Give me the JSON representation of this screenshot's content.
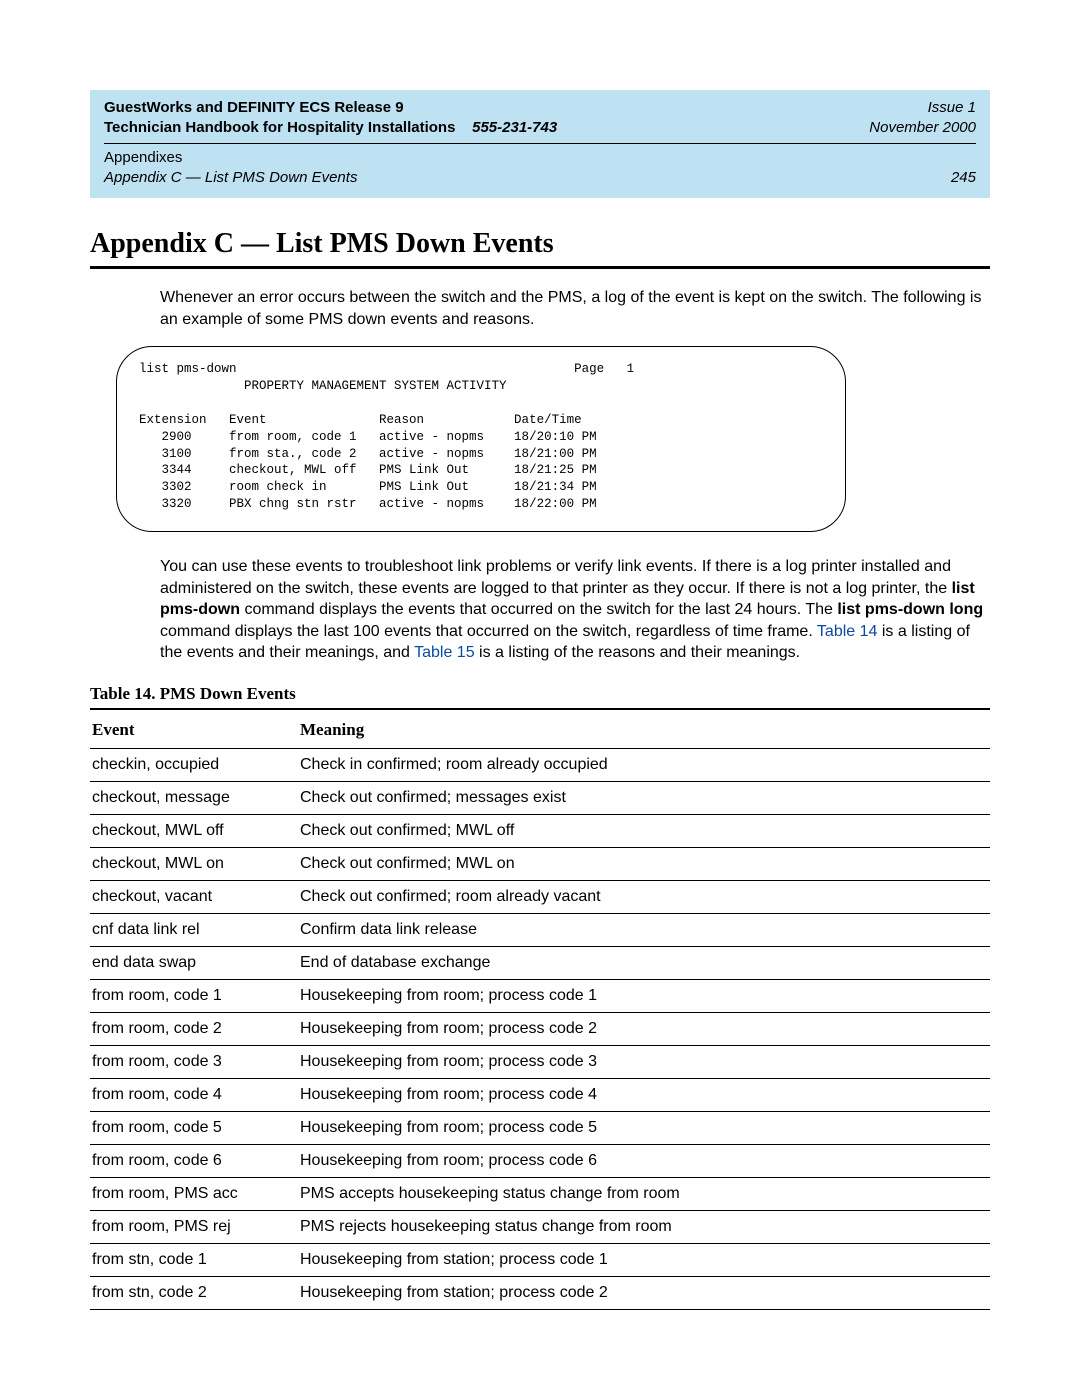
{
  "header": {
    "title_line": "GuestWorks and DEFINITY ECS Release 9",
    "handbook_line": "Technician Handbook for Hospitality Installations",
    "docnum": "555-231-743",
    "issue": "Issue 1",
    "date": "November 2000",
    "section_group": "Appendixes",
    "section_line": "Appendix C — List PMS Down Events",
    "pagenum": "245"
  },
  "title": "Appendix C — List PMS Down Events",
  "intro": "Whenever an error occurs between the switch and the PMS, a log of the event is kept on the switch. The following is an example of some PMS down events and reasons.",
  "terminal": {
    "cmd_line_left": "list pms-down",
    "cmd_line_right": "Page   1",
    "banner": "PROPERTY MANAGEMENT SYSTEM ACTIVITY",
    "columns": [
      "Extension",
      "Event",
      "Reason",
      "Date/Time"
    ],
    "rows": [
      {
        "ext": "2900",
        "event": "from room, code 1",
        "reason": "active - nopms",
        "dt": "18/20:10 PM"
      },
      {
        "ext": "3100",
        "event": "from sta., code 2",
        "reason": "active - nopms",
        "dt": "18/21:00 PM"
      },
      {
        "ext": "3344",
        "event": "checkout, MWL off",
        "reason": "PMS Link Out",
        "dt": "18/21:25 PM"
      },
      {
        "ext": "3302",
        "event": "room check in",
        "reason": "PMS Link Out",
        "dt": "18/21:34 PM"
      },
      {
        "ext": "3320",
        "event": "PBX chng stn rstr",
        "reason": "active - nopms",
        "dt": "18/22:00 PM"
      }
    ]
  },
  "para2": {
    "t1": "You can use these events to troubleshoot link problems or verify link events. If there is a log printer installed and administered on the switch, these events are logged to that printer as they occur. If there is not a log printer, the ",
    "cmd1": "list pms-down",
    "t2": " command displays the events that occurred on the switch for the last 24 hours. The ",
    "cmd2": "list pms-down long",
    "t3": " command displays the last 100 events that occurred on the switch, regardless of time frame. ",
    "link1": "Table 14",
    "t4": " is a listing of the events and their meanings, and ",
    "link2": "Table 15",
    "t5": " is a listing of the reasons and their meanings."
  },
  "table14": {
    "caption": "Table 14.  PMS Down Events",
    "headers": {
      "event": "Event",
      "meaning": "Meaning"
    },
    "rows": [
      {
        "event": "checkin, occupied",
        "meaning": "Check in confirmed; room already occupied"
      },
      {
        "event": "checkout, message",
        "meaning": "Check out confirmed; messages exist"
      },
      {
        "event": "checkout, MWL off",
        "meaning": "Check out confirmed; MWL off"
      },
      {
        "event": "checkout, MWL on",
        "meaning": "Check out confirmed; MWL on"
      },
      {
        "event": "checkout, vacant",
        "meaning": "Check out confirmed; room already vacant"
      },
      {
        "event": "cnf data link rel",
        "meaning": "Confirm data link release"
      },
      {
        "event": "end data swap",
        "meaning": "End of database exchange"
      },
      {
        "event": "from room, code 1",
        "meaning": "Housekeeping from room; process code 1"
      },
      {
        "event": "from room, code 2",
        "meaning": "Housekeeping from room; process code 2"
      },
      {
        "event": "from room, code 3",
        "meaning": "Housekeeping from room; process code 3"
      },
      {
        "event": "from room, code 4",
        "meaning": "Housekeeping from room; process code 4"
      },
      {
        "event": "from room, code 5",
        "meaning": "Housekeeping from room; process code 5"
      },
      {
        "event": "from room, code 6",
        "meaning": "Housekeeping from room; process code 6"
      },
      {
        "event": "from room, PMS acc",
        "meaning": "PMS accepts housekeeping status change from room"
      },
      {
        "event": "from room, PMS rej",
        "meaning": "PMS rejects housekeeping status change from room"
      },
      {
        "event": "from stn, code 1",
        "meaning": "Housekeeping from station; process code 1"
      },
      {
        "event": "from stn, code 2",
        "meaning": "Housekeeping from station; process code 2"
      }
    ]
  }
}
